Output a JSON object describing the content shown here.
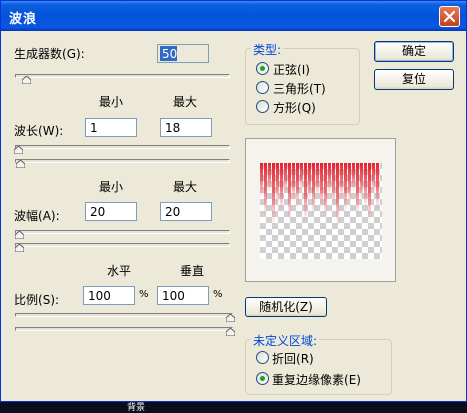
{
  "dialog": {
    "title": "波浪",
    "close_icon": "close-x-icon"
  },
  "generators": {
    "label": "生成器数",
    "hotkey": "(G):",
    "value": "50"
  },
  "wavelength": {
    "min_header": "最小",
    "max_header": "最大",
    "label": "波长",
    "hotkey": "(W):",
    "min_value": "1",
    "max_value": "18"
  },
  "amplitude": {
    "min_header": "最小",
    "max_header": "最大",
    "label": "波幅",
    "hotkey": "(A):",
    "min_value": "20",
    "max_value": "20"
  },
  "scale": {
    "horizontal_header": "水平",
    "vertical_header": "垂直",
    "label": "比例",
    "hotkey": "(S):",
    "horizontal_value": "100",
    "vertical_value": "100",
    "unit": "%"
  },
  "type_group": {
    "title": "类型:",
    "options": [
      {
        "label": "正弦",
        "hotkey": "(I)",
        "selected": true
      },
      {
        "label": "三角形",
        "hotkey": "(T)",
        "selected": false
      },
      {
        "label": "方形",
        "hotkey": "(Q)",
        "selected": false
      }
    ]
  },
  "buttons": {
    "ok": "确定",
    "reset": "复位",
    "randomize": "随机化",
    "randomize_hotkey": "(Z)"
  },
  "undefined_area": {
    "title": "未定义区域:",
    "options": [
      {
        "label": "折回",
        "hotkey": "(R)",
        "selected": false
      },
      {
        "label": "重复边缘像素",
        "hotkey": "(E)",
        "selected": true
      }
    ]
  },
  "background_layer": {
    "label": "背景"
  },
  "colors": {
    "title_bar": "#0553d8",
    "dialog_bg": "#ece9d8",
    "group_title": "#0046d5",
    "selection": "#316ac5",
    "preview_wave": "#e8202a",
    "radio_selected": "#21a121"
  },
  "preview": {
    "description_icon": "wave-preview-image"
  }
}
